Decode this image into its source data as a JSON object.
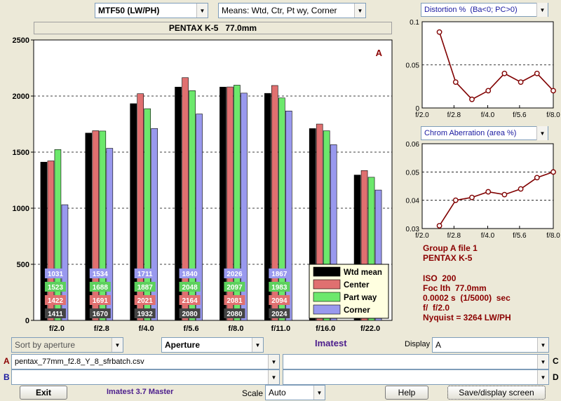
{
  "top": {
    "metric_select": "MTF50 (LW/PH)",
    "means_select": "Means: Wtd, Ctr, Pt wy, Corner",
    "camera_title": "PENTAX K-5   77.0mm"
  },
  "chart_data": [
    {
      "type": "bar",
      "categories": [
        "f/2.0",
        "f/2.8",
        "f/4.0",
        "f/5.6",
        "f/8.0",
        "f/11.0",
        "f/16.0",
        "f/22.0"
      ],
      "series": [
        {
          "name": "Wtd mean",
          "color": "#000000",
          "values": [
            1411,
            1670,
            1932,
            2080,
            2080,
            2024,
            1710,
            1296
          ]
        },
        {
          "name": "Center",
          "color": "#e07070",
          "values": [
            1422,
            1691,
            2021,
            2164,
            2081,
            2094,
            1750,
            1336
          ]
        },
        {
          "name": "Part way",
          "color": "#6ce86c",
          "values": [
            1523,
            1688,
            1887,
            2048,
            2097,
            1983,
            1690,
            1276
          ]
        },
        {
          "name": "Corner",
          "color": "#9999ee",
          "values": [
            1031,
            1534,
            1711,
            1840,
            2026,
            1867,
            1566,
            1162
          ]
        }
      ],
      "label_cat_count": 6,
      "ylim": [
        0,
        2500
      ],
      "yticks": [
        0,
        500,
        1000,
        1500,
        2000,
        2500
      ],
      "corner_label": "A",
      "legend": "bottom-right",
      "grid": true
    },
    {
      "type": "line",
      "title_select": "Distortion %  (Ba<0; PC>0)",
      "x": [
        2.0,
        2.8,
        4.0,
        5.6,
        8.0
      ],
      "xticks": [
        "f/2.0",
        "f/2.8",
        "f/4.0",
        "f/5.6",
        "f/8.0"
      ],
      "points": [
        0.088,
        0.03,
        0.01,
        0.02,
        0.04,
        0.03,
        0.04,
        0.02
      ],
      "ylim": [
        0,
        0.1
      ],
      "yticks": [
        "0",
        "0.05",
        "0.1"
      ],
      "line_color": "#800000"
    },
    {
      "type": "line",
      "title_select": "Chrom Aberration (area %)",
      "x": [
        2.0,
        2.8,
        4.0,
        5.6,
        8.0
      ],
      "xticks": [
        "f/2.0",
        "f/2.8",
        "f/4.0",
        "f/5.6",
        "f/8.0"
      ],
      "points": [
        0.031,
        0.04,
        0.041,
        0.043,
        0.042,
        0.044,
        0.048,
        0.05
      ],
      "ylim": [
        0.03,
        0.06
      ],
      "yticks": [
        "0.03",
        "0.04",
        "0.05",
        "0.06"
      ],
      "line_color": "#800000"
    }
  ],
  "info": {
    "line1": "Group A file 1",
    "line2": "PENTAX K-5",
    "line3": "ISO  200",
    "line4": "Foc lth  77.0mm",
    "line5": "0.0002 s  (1/5000)  sec",
    "line6": "f/  f/2.0",
    "line7": "Nyquist = 3264 LW/PH"
  },
  "controls": {
    "sort_select": "Sort by aperture",
    "aperture_select": "Aperture",
    "brand": "Imatest",
    "display_label": "Display",
    "display_select": "A",
    "row_a_label": "A",
    "row_b_label": "B",
    "row_c_label": "C",
    "row_d_label": "D",
    "file_a": "pentax_77mm_f2.8_Y_8_sfrbatch.csv",
    "file_b": "",
    "file_c": "",
    "file_d": ""
  },
  "bottom": {
    "exit_label": "Exit",
    "version": "Imatest 3.7 Master",
    "scale_label": "Scale",
    "scale_select": "Auto",
    "help_label": "Help",
    "save_label": "Save/display screen"
  },
  "arrow_glyph": "▼"
}
